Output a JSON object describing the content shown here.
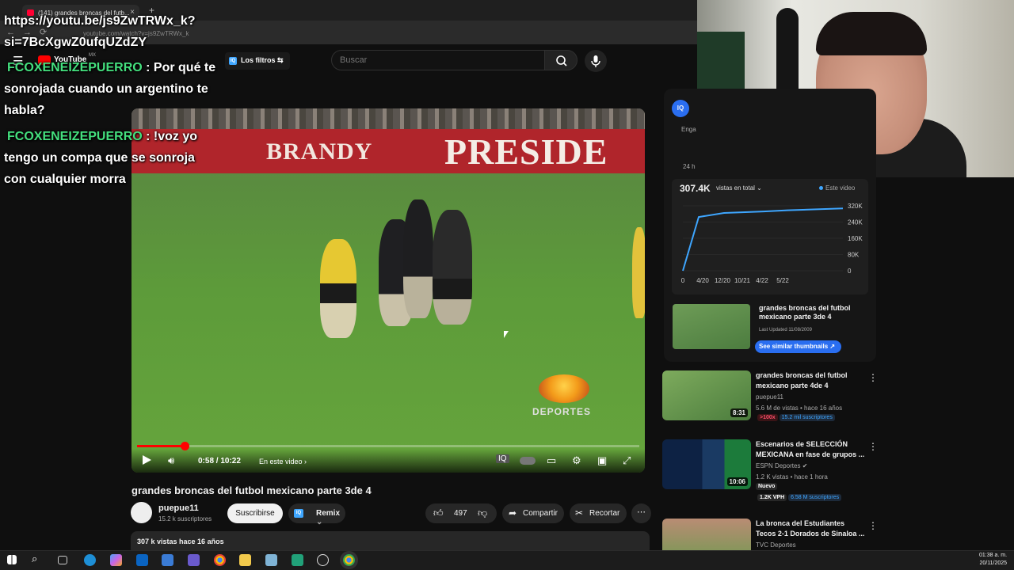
{
  "browser": {
    "tab_title": "(141) grandes broncas del futb...",
    "url": "youtube.com/watch?v=js9ZwTRWx_k"
  },
  "header": {
    "logo_text": "YouTube",
    "logo_region": "MX",
    "filters_label": "Los filtros",
    "search_placeholder": "Buscar"
  },
  "chat": [
    {
      "user": "",
      "text": "https://youtu.be/js9ZwTRWx_k?"
    },
    {
      "user": "",
      "text": "si=7BcXgwZ0ufqUZdZY"
    },
    {
      "user": "FCOXENEIZEPUERRO",
      "text": ": Por qué te"
    },
    {
      "user": "",
      "text": "sonrojada cuando un argentino te"
    },
    {
      "user": "",
      "text": "habla?"
    },
    {
      "user": "FCOXENEIZEPUERRO",
      "text": ": !voz yo"
    },
    {
      "user": "",
      "text": "tengo un compa que se sonroja"
    },
    {
      "user": "",
      "text": "con cualquier morra"
    }
  ],
  "player": {
    "banner_left": "BRANDY",
    "banner_right": "PRESIDE",
    "watermark": "DEPORTES",
    "time": "0:58 / 10:22",
    "chapter": "En este video",
    "progress": 0.095
  },
  "video": {
    "title": "grandes broncas del futbol mexicano parte 3de 4",
    "channel": "puepue11",
    "subscribers": "15.2 k suscriptores",
    "subscribe_label": "Suscribirse",
    "remix_label": "Remix",
    "likes": "497",
    "share_label": "Compartir",
    "clip_label": "Recortar",
    "desc_views": "307 k vistas  hace 16 años"
  },
  "iq_panel": {
    "badge": "IQ",
    "eng_label": "Enga",
    "h24_label": "24 h",
    "total_views": "307.4K",
    "views_dropdown": "vistas en total",
    "this_video": "Este video",
    "thumb_title": "grandes broncas del futbol mexicano parte 3de 4",
    "last_updated": "Last Updated 11/08/2009",
    "similar_btn": "See similar thumbnails"
  },
  "chart_data": {
    "type": "line",
    "x": [
      "0",
      "4/20",
      "12/20",
      "10/21",
      "4/22",
      "5/22"
    ],
    "values": [
      0,
      265000,
      285000,
      292000,
      298000,
      307400
    ],
    "y_ticks": [
      "0",
      "80K",
      "160K",
      "240K",
      "320K"
    ],
    "ylim": [
      0,
      320000
    ],
    "grid": true
  },
  "recommendations": [
    {
      "title": "grandes broncas del futbol mexicano parte 4de 4",
      "channel": "puepue11",
      "meta": "5.6 M de vistas • hace 16 años",
      "duration": "8:31",
      "badge1": ">100x",
      "badge2": "15.2 mil suscriptores"
    },
    {
      "title": "Escenarios de SELECCIÓN MEXICANA en fase de grupos ...",
      "channel": "ESPN Deportes",
      "meta": "1.2 K vistas • hace 1 hora",
      "duration": "10:06",
      "new_label": "Nuevo",
      "badge1": "1.2K VPH",
      "badge2": "6.58 M suscriptores"
    },
    {
      "title": "La bronca del Estudiantes Tecos 2-1 Dorados de Sinaloa ...",
      "channel": "TVC Deportes",
      "meta": "",
      "duration": ""
    }
  ],
  "taskbar": {
    "time": "01:38 a. m.",
    "date": "20/11/2025"
  }
}
